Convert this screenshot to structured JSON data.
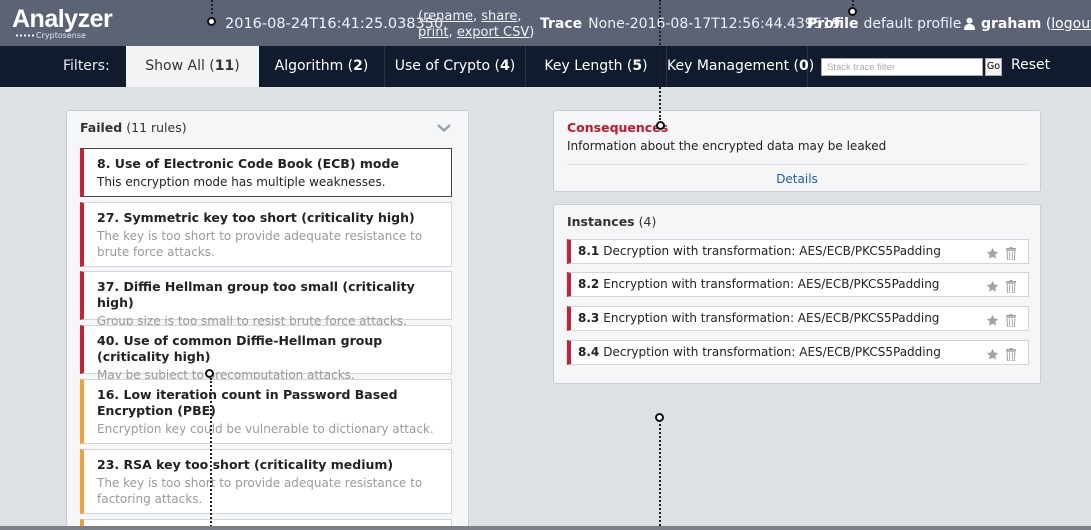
{
  "header": {
    "logo_text": "Analyzer",
    "logo_sub": "Cryptosense",
    "timestamp": "2016-08-24T16:41:25.038350",
    "links_open": "(",
    "links": [
      "rename",
      "share",
      "print",
      "export CSV"
    ],
    "links_close": ")",
    "trace_label": "Trace",
    "trace_value": "None-2016-08-17T12:56:44.439519",
    "profile_label": "Profile",
    "profile_value": "default profile",
    "user": "graham",
    "logout": "logout",
    "user_icon": "user-icon"
  },
  "filters": {
    "label": "Filters:",
    "tabs": [
      {
        "label": "Show All",
        "count": "11",
        "active": true
      },
      {
        "label": "Algorithm",
        "count": "2",
        "active": false
      },
      {
        "label": "Use of Crypto",
        "count": "4",
        "active": false
      },
      {
        "label": "Key Length",
        "count": "5",
        "active": false
      },
      {
        "label": "Key Management",
        "count": "0",
        "active": false
      }
    ],
    "search_placeholder": "Stack trace filter",
    "go": "Go",
    "reset": "Reset"
  },
  "failed": {
    "title": "Failed",
    "count_text": "(11 rules)",
    "rules": [
      {
        "title": "8. Use of Electronic Code Book (ECB) mode",
        "desc": "This encryption mode has multiple weaknesses.",
        "severity": "high",
        "selected": true
      },
      {
        "title": "27. Symmetric key too short (criticality high)",
        "desc": "The key is too short to provide adequate resistance to brute force attacks.",
        "severity": "high"
      },
      {
        "title": "37. Diffie Hellman group too small (criticality high)",
        "desc": "Group size is too small to resist brute force attacks.",
        "severity": "high"
      },
      {
        "title": "40. Use of common Diffie-Hellman group (criticality high)",
        "desc": "May be subject to precomputation attacks.",
        "severity": "high"
      },
      {
        "title": "16. Low iteration count in Password Based Encryption (PBE)",
        "desc": "Encryption key could be vulnerable to dictionary attack.",
        "severity": "medium"
      },
      {
        "title": "23. RSA key too short (criticality medium)",
        "desc": "The key is too short to provide adequate resistance to factoring attacks.",
        "severity": "medium"
      }
    ]
  },
  "consequences": {
    "title": "Consequences",
    "text": "Information about the encrypted data may be leaked",
    "details": "Details"
  },
  "instances": {
    "title": "Instances",
    "count_text": "(4)",
    "items": [
      {
        "id": "8.1",
        "text": "Decryption with transformation: AES/ECB/PKCS5Padding"
      },
      {
        "id": "8.2",
        "text": "Encryption with transformation: AES/ECB/PKCS5Padding"
      },
      {
        "id": "8.3",
        "text": "Encryption with transformation: AES/ECB/PKCS5Padding"
      },
      {
        "id": "8.4",
        "text": "Decryption with transformation: AES/ECB/PKCS5Padding"
      }
    ]
  },
  "colors": {
    "header_bg": "#5b6374",
    "filterbar_bg": "#111b2e",
    "high": "#d11f32",
    "medium": "#f1a136",
    "link": "#1c5fb0"
  }
}
